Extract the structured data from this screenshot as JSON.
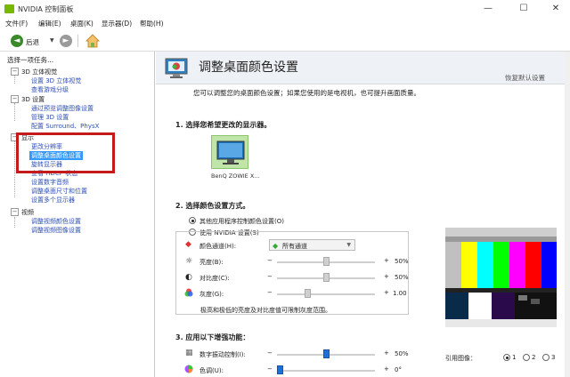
{
  "window": {
    "title": "NVIDIA 控制面板",
    "min": "—",
    "max": "☐",
    "close": "✕"
  },
  "menu": [
    "文件(F)",
    "编辑(E)",
    "桌面(K)",
    "显示器(D)",
    "帮助(H)"
  ],
  "toolbar": {
    "back": "后退",
    "back_arrow": "◄",
    "forward_arrow": "►",
    "dropdown": "▼"
  },
  "left": {
    "title": "选择一项任务...",
    "tree": [
      {
        "type": "cat",
        "label": "3D 立体视觉"
      },
      {
        "type": "link",
        "label": "设置 3D 立体视觉"
      },
      {
        "type": "link",
        "label": "查看游戏分级"
      },
      {
        "type": "cat",
        "label": "3D 设置"
      },
      {
        "type": "link",
        "label": "通过预览调整图像设置"
      },
      {
        "type": "link",
        "label": "管理 3D 设置"
      },
      {
        "type": "link",
        "label": "配置 Surround、PhysX"
      },
      {
        "type": "cat",
        "label": "显示"
      },
      {
        "type": "link",
        "label": "更改分辨率"
      },
      {
        "type": "sel",
        "label": "调整桌面颜色设置"
      },
      {
        "type": "link",
        "label": "旋转显示器"
      },
      {
        "type": "link",
        "label": "查看 HDCP 状态"
      },
      {
        "type": "link",
        "label": "设置数字音频"
      },
      {
        "type": "link",
        "label": "调整桌面尺寸和位置"
      },
      {
        "type": "link",
        "label": "设置多个显示器"
      },
      {
        "type": "cat",
        "label": "视频"
      },
      {
        "type": "link",
        "label": "调整视频颜色设置"
      },
      {
        "type": "link",
        "label": "调整视频图像设置"
      }
    ],
    "expand_symbol": "−"
  },
  "right": {
    "title": "调整桌面颜色设置",
    "restore": "恢复默认设置",
    "description": "您可以调整您的桌面颜色设置；如果您使用的是电视机，也可提升画面质量。",
    "s1": "1. 选择您希望更改的显示器。",
    "monitor_label": "BenQ ZOWIE X...",
    "s2": "2. 选择颜色设置方式。",
    "opt_other": "其他应用程序控制颜色设置(O)",
    "opt_nvidia": "使用 NVIDIA 设置(S)",
    "channel_label": "颜色通道(H):",
    "channel_value": "所有通道",
    "brightness_label": "亮度(B):",
    "brightness_value": "50%",
    "contrast_label": "对比度(C):",
    "contrast_value": "50%",
    "gamma_label": "灰度(G):",
    "gamma_value": "1.00",
    "note": "极高和极低的亮度及对比度值可限制灰度范围。",
    "s3": "3. 应用以下增强功能：",
    "vibrance_label": "数字振动控制(I):",
    "vibrance_value": "50%",
    "hue_label": "色调(U):",
    "hue_value": "0°",
    "ref_label": "引用图像：",
    "ref_opts": [
      "1",
      "2",
      "3"
    ],
    "minus": "−",
    "plus": "+"
  },
  "levels": {
    "brightness": 0.5,
    "contrast": 0.5,
    "gamma": 0.3,
    "vibrance": 0.5,
    "hue": 0.0
  },
  "colors": {
    "nvidia_green": "#76b900",
    "link": "#2d4fb5",
    "selection": "#3399ff",
    "highlight_box": "#c41a1a"
  }
}
